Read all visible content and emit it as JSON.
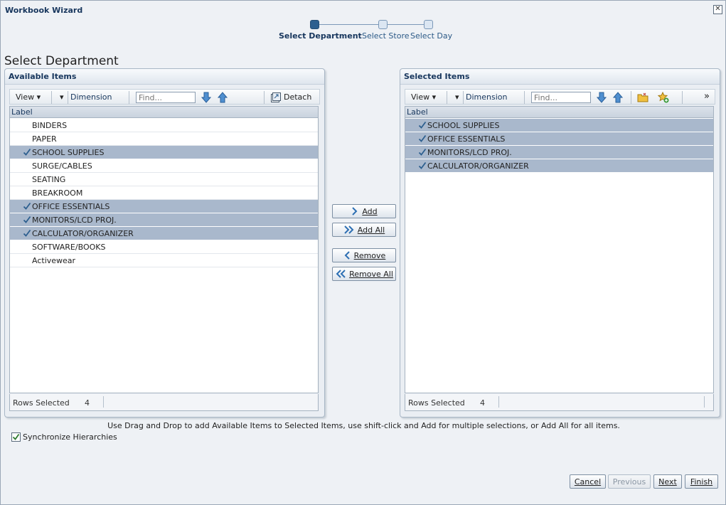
{
  "dialog": {
    "title": "Workbook Wizard",
    "close_glyph": "✕"
  },
  "train": {
    "steps": [
      {
        "label": "Select Department",
        "active": true
      },
      {
        "label": "Select Store",
        "active": false
      },
      {
        "label": "Select Day",
        "active": false
      }
    ]
  },
  "page_title": "Select Department",
  "available": {
    "title": "Available Items",
    "toolbar": {
      "view": "View",
      "dimension": "Dimension",
      "find_placeholder": "Find...",
      "detach": "Detach"
    },
    "column": "Label",
    "rows": [
      {
        "label": "BINDERS",
        "selected": false
      },
      {
        "label": "PAPER",
        "selected": false
      },
      {
        "label": "SCHOOL SUPPLIES",
        "selected": true
      },
      {
        "label": "SURGE/CABLES",
        "selected": false
      },
      {
        "label": "SEATING",
        "selected": false
      },
      {
        "label": "BREAKROOM",
        "selected": false
      },
      {
        "label": "OFFICE ESSENTIALS",
        "selected": true
      },
      {
        "label": "MONITORS/LCD PROJ.",
        "selected": true
      },
      {
        "label": "CALCULATOR/ORGANIZER",
        "selected": true
      },
      {
        "label": "SOFTWARE/BOOKS",
        "selected": false
      },
      {
        "label": "Activewear",
        "selected": false
      }
    ],
    "status": {
      "label": "Rows Selected",
      "value": "4"
    }
  },
  "selected": {
    "title": "Selected Items",
    "toolbar": {
      "view": "View",
      "dimension": "Dimension",
      "find_placeholder": "Find...",
      "more": "»"
    },
    "column": "Label",
    "rows": [
      {
        "label": "SCHOOL SUPPLIES",
        "selected": true
      },
      {
        "label": "OFFICE ESSENTIALS",
        "selected": true
      },
      {
        "label": "MONITORS/LCD PROJ.",
        "selected": true
      },
      {
        "label": "CALCULATOR/ORGANIZER",
        "selected": true
      }
    ],
    "status": {
      "label": "Rows Selected",
      "value": "4"
    }
  },
  "shuttle": {
    "add": "Add",
    "add_all": "Add All",
    "remove": "Remove",
    "remove_all": "Remove All"
  },
  "hint": "Use Drag and Drop to add Available Items to Selected Items, use shift-click and Add for multiple selections, or Add All for all items.",
  "sync": {
    "label": "Synchronize Hierarchies",
    "checked": true
  },
  "footer": {
    "cancel": "Cancel",
    "previous": "Previous",
    "next": "Next",
    "finish": "Finish"
  },
  "colors": {
    "accent": "#17365d",
    "selection": "#a9b8cc",
    "check": "#2d5f8f"
  }
}
